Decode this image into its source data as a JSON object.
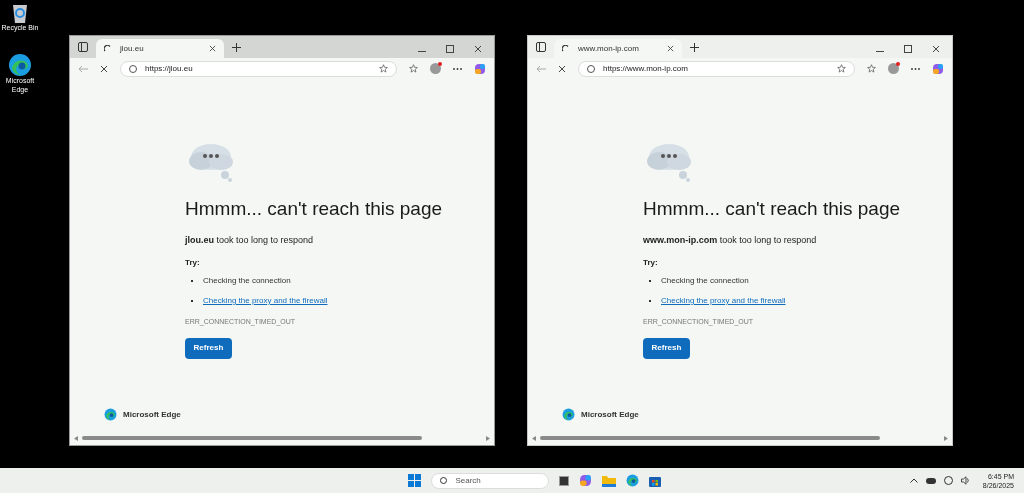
{
  "desktop_icons": [
    {
      "kind": "recycle",
      "label": "Recycle Bin"
    },
    {
      "kind": "edge",
      "label": "Microsoft Edge"
    }
  ],
  "windows": [
    {
      "active": true,
      "tab_title": "jlou.eu",
      "address": "https://jlou.eu",
      "heading": "Hmmm... can't reach this page",
      "message": "**jlou.eu** took too long to respond",
      "try_label": "Try:",
      "suggestions": [
        {
          "kind": "text",
          "text": "Checking the connection"
        },
        {
          "kind": "link",
          "text": "Checking the proxy and the firewall"
        }
      ],
      "error_code": "ERR_CONNECTION_TIMED_OUT",
      "button": "Refresh",
      "brand": "Microsoft Edge"
    },
    {
      "active": false,
      "tab_title": "www.mon-ip.com",
      "address": "https://www.mon-ip.com",
      "heading": "Hmmm... can't reach this page",
      "message": "**www.mon-ip.com** took too long to respond",
      "try_label": "Try:",
      "suggestions": [
        {
          "kind": "text",
          "text": "Checking the connection"
        },
        {
          "kind": "link",
          "text": "Checking the proxy and the firewall"
        }
      ],
      "error_code": "ERR_CONNECTION_TIMED_OUT",
      "button": "Refresh",
      "brand": "Microsoft Edge"
    }
  ],
  "taskbar": {
    "search_placeholder": "Search",
    "time": "6:45 PM",
    "date": "8/26/2025"
  }
}
